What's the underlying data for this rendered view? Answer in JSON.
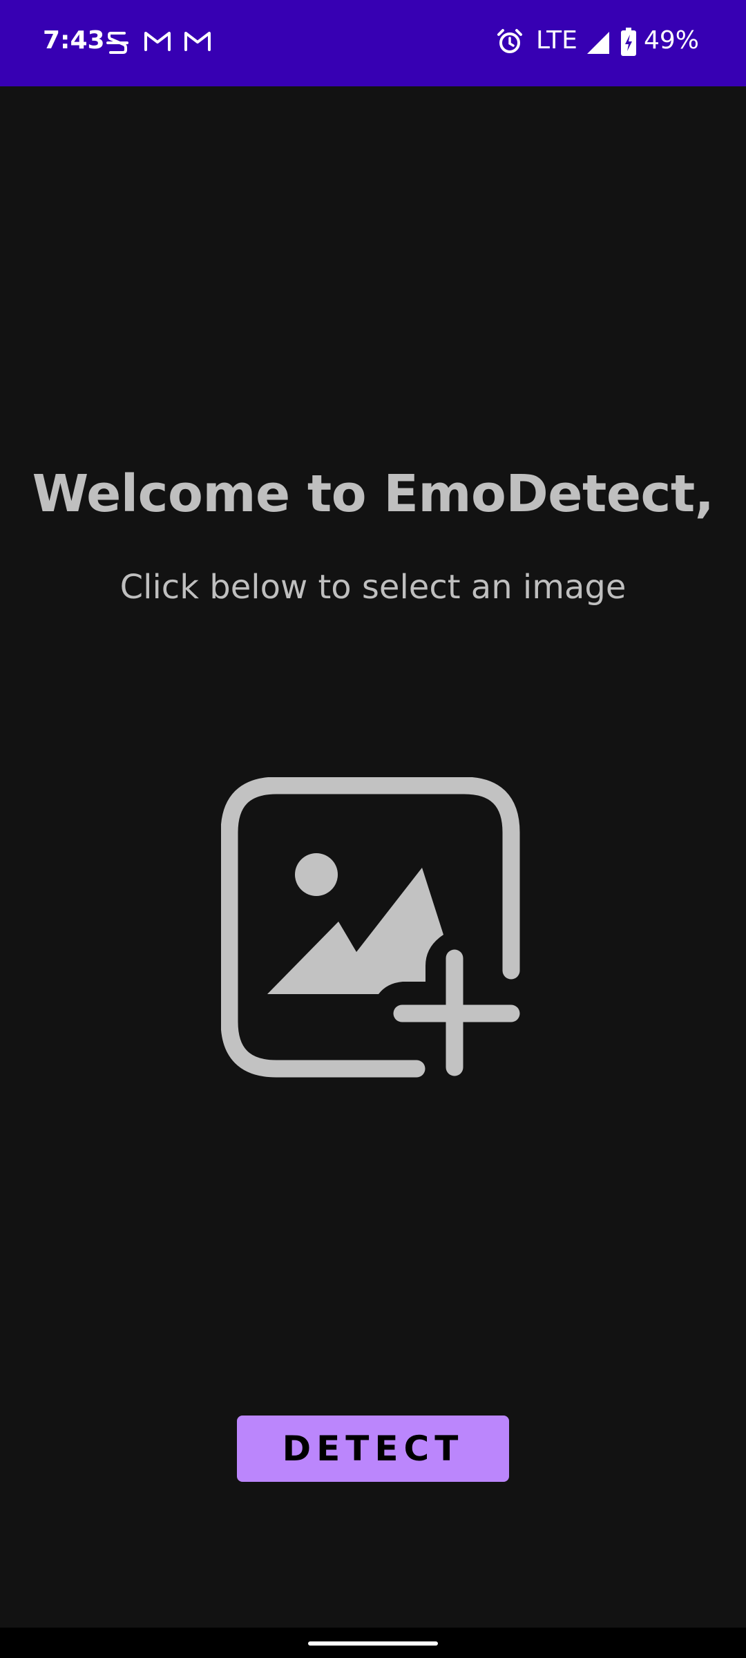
{
  "status_bar": {
    "time": "7:43",
    "network": "LTE",
    "battery": "49%",
    "notification_icons": [
      "s-notification-icon",
      "gmail-icon",
      "gmail-icon"
    ],
    "right_icons": [
      "alarm-icon",
      "signal-icon",
      "battery-charging-icon"
    ],
    "background": "#3700b3"
  },
  "main": {
    "title": "Welcome to EmoDetect,",
    "subtitle": "Click below to select an image",
    "image_picker_icon": "add-photo-icon"
  },
  "actions": {
    "detect_label": "DETECT"
  },
  "colors": {
    "background": "#121212",
    "accent": "#bb86fc",
    "text_muted": "#bfbfbf"
  }
}
